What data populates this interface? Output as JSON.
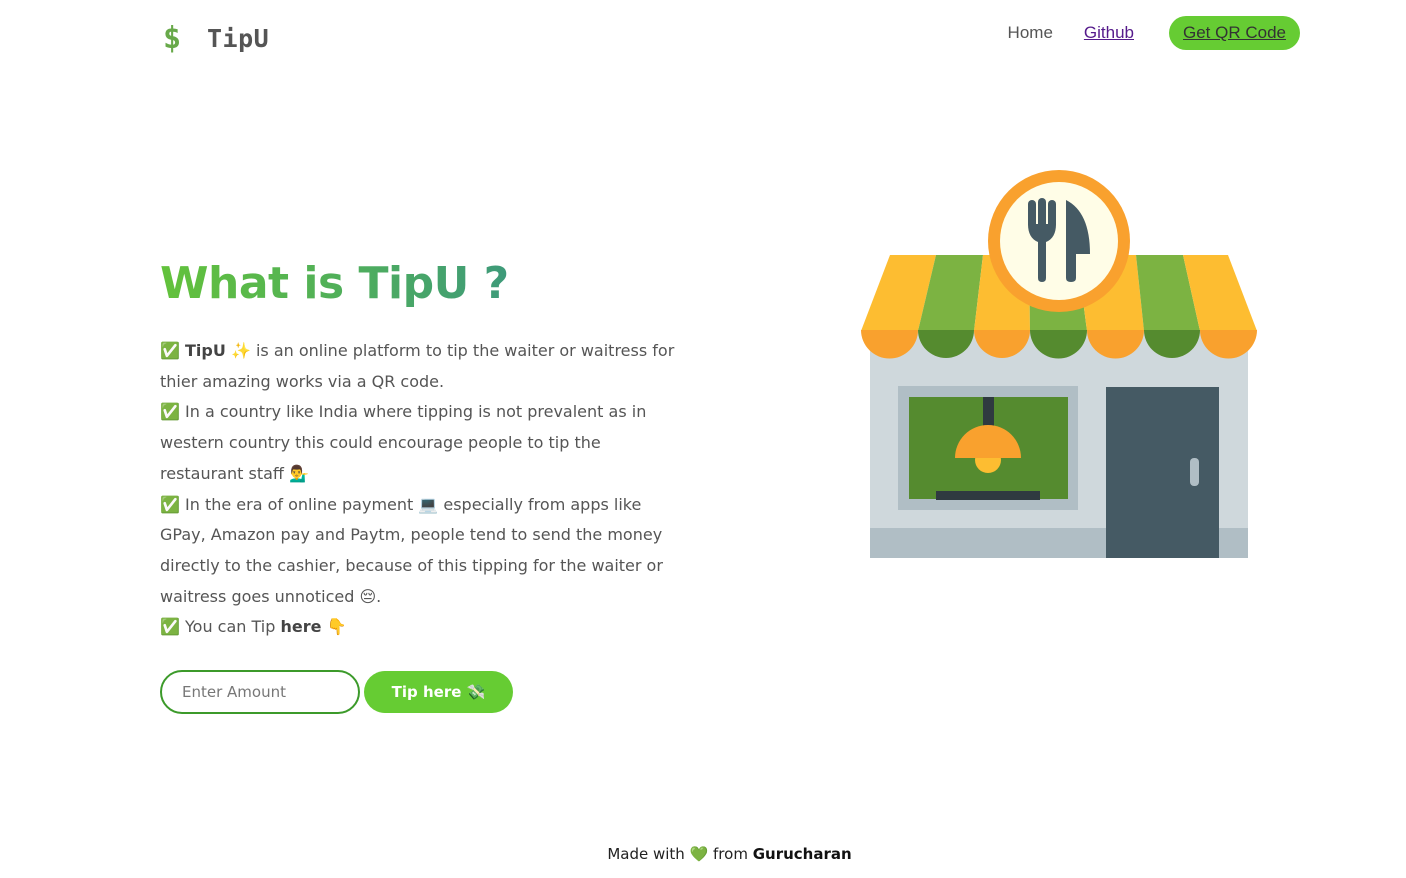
{
  "header": {
    "logo_symbol": "$",
    "logo_text": "TipU",
    "nav": {
      "home": "Home",
      "github": "Github",
      "cta": "Get QR Code"
    }
  },
  "hero": {
    "title": "What is TipU ?",
    "points": [
      {
        "check": "✅",
        "pre": " ",
        "bold": "TipU",
        "post": " ✨ is an online platform to tip the waiter or waitress for thier amazing works via a QR code."
      },
      {
        "check": "✅",
        "text": " In a country like India where tipping is not prevalent as in western country this could encourage people to tip the restaurant staff 💁‍♂️"
      },
      {
        "check": "✅",
        "text": " In the era of online payment 💻 especially from apps like GPay, Amazon pay and Paytm, people tend to send the money directly to the cashier, because of this tipping for the waiter or waitress goes unnoticed 😔."
      },
      {
        "check": "✅",
        "pre": " You can Tip ",
        "bold": "here",
        "post": " 👇"
      }
    ],
    "form": {
      "amount_placeholder": "Enter Amount",
      "submit_label": "Tip here 💸"
    }
  },
  "illustration": {
    "icon": "restaurant-storefront-icon",
    "colors": {
      "awning_yellow": "#fdbd31",
      "awning_green": "#7cb342",
      "awning_scallop_orange": "#f9a12e",
      "awning_scallop_green": "#558b2f",
      "wall": "#cfd8dc",
      "base": "#b0bec5",
      "window_frame": "#b0bec5",
      "window_glass": "#558b2f",
      "door": "#455a64",
      "sign_ring": "#f9a12e",
      "sign_face": "#fffde7",
      "utensils": "#455a64"
    }
  },
  "footer": {
    "pre": "Made with ",
    "heart": "💚",
    "mid": " from ",
    "author": "Gurucharan"
  },
  "colors": {
    "brand_green": "#66cc33",
    "title_gradient_start": "#63c23b",
    "title_gradient_end": "#3e9a7a",
    "input_border": "#3c9a2a",
    "visited_link": "#551a8b"
  }
}
